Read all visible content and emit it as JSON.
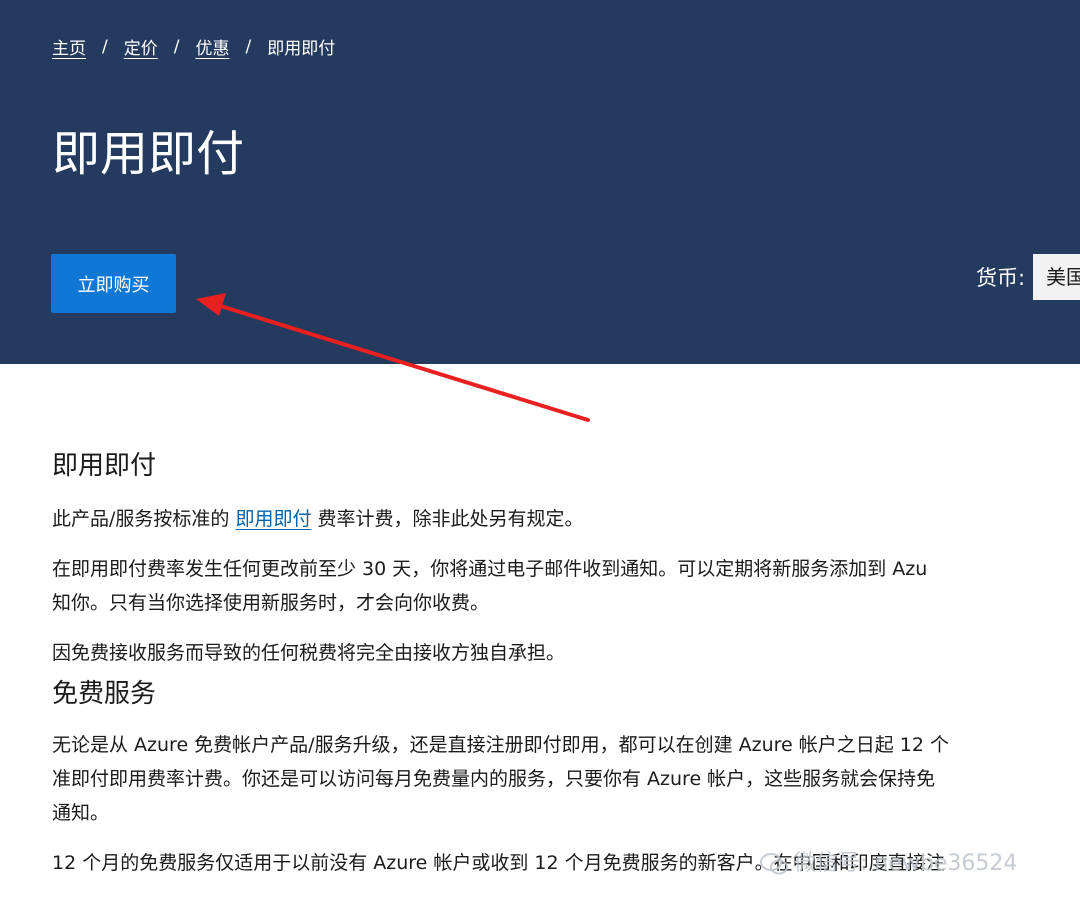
{
  "breadcrumb": {
    "items": [
      "主页",
      "定价",
      "优惠"
    ],
    "current": "即用即付",
    "separator": "/"
  },
  "hero": {
    "title": "即用即付",
    "buy_button": "立即购买",
    "currency_label": "货币:",
    "currency_value": "美国"
  },
  "content": {
    "section1_title": "即用即付",
    "p1_before": "此产品/服务按标准的 ",
    "p1_link": "即用即付",
    "p1_after": " 费率计费，除非此处另有规定。",
    "p2_line1": "在即用即付费率发生任何更改前至少 30 天，你将通过电子邮件收到通知。可以定期将新服务添加到 Azu",
    "p2_line2": "知你。只有当你选择使用新服务时，才会向你收费。",
    "p3": "因免费接收服务而导致的任何税费将完全由接收方独自承担。",
    "section2_title": "免费服务",
    "p4_line1": "无论是从 Azure 免费帐户产品/服务升级，还是直接注册即付即用，都可以在创建 Azure 帐户之日起 12 个",
    "p4_line2": "准即付即用费率计费。你还是可以访问每月免费量内的服务，只要你有 Azure 帐户，这些服务就会保持免",
    "p4_line3": "通知。",
    "p5": "12 个月的免费服务仅适用于以前没有 Azure 帐户或收到 12 个月免费服务的新客户。在中国和印度直接注"
  },
  "watermark": {
    "text": "微信号: newbe36524"
  },
  "colors": {
    "hero_bg": "#243a5e",
    "button_bg": "#0f78d4",
    "link": "#0062ad",
    "annotation_arrow": "#e8201f"
  }
}
